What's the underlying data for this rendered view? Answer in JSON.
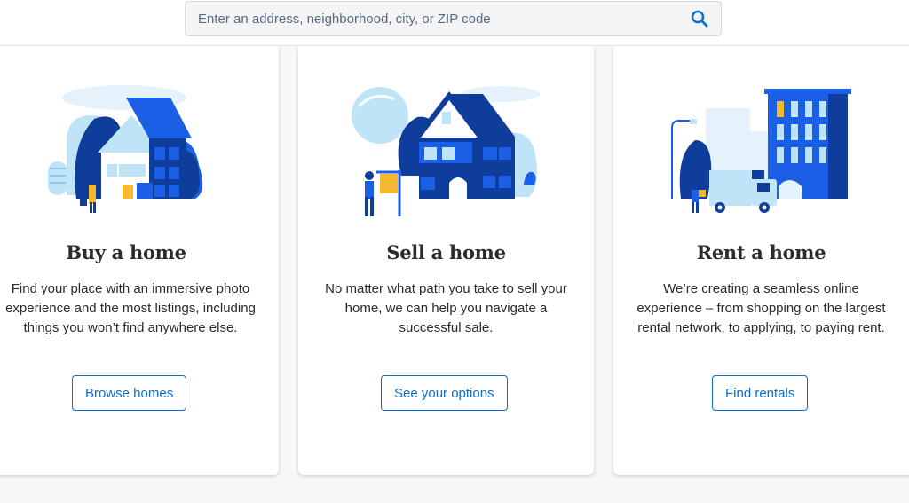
{
  "search": {
    "placeholder": "Enter an address, neighborhood, city, or ZIP code",
    "icon": "search-icon"
  },
  "cards": [
    {
      "title": "Buy a home",
      "description": "Find your place with an immersive photo experience and the most listings, including things you won’t find anywhere else.",
      "button_label": "Browse homes",
      "illustration": "buy-home-illustration"
    },
    {
      "title": "Sell a home",
      "description": "No matter what path you take to sell your home, we can help you navigate a successful sale.",
      "button_label": "See your options",
      "illustration": "sell-home-illustration"
    },
    {
      "title": "Rent a home",
      "description": "We’re creating a seamless online experience – from shopping on the largest rental network, to applying, to paying rent.",
      "button_label": "Find rentals",
      "illustration": "rent-home-illustration"
    }
  ],
  "colors": {
    "accent": "#0d6ece",
    "illustration_dark": "#0f3d9c",
    "illustration_mid": "#1a5fe6",
    "illustration_light": "#bfe3f7",
    "illustration_yellow": "#f5b82e"
  }
}
